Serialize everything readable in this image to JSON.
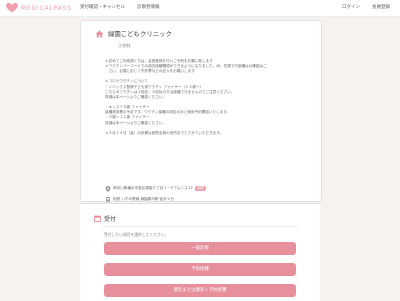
{
  "colors": {
    "brand": "#f2a1ac",
    "primary_button": "#e88f9c",
    "page_bg": "#f6f2ef"
  },
  "header": {
    "logo_icon": "heart-logo-icon",
    "logo_text": "MEDICALPASS",
    "nav": [
      "受付確認・キャンセル",
      "診察券情報"
    ],
    "login": "ログイン",
    "register": "会員登録"
  },
  "clinic": {
    "icon": "home-icon",
    "name": "緑園こどもクリニック",
    "department": "小児科"
  },
  "notice": [
    "＊初めてご利用頂く方は、会員登録を行いご予約をお願い致します",
    "＊ワクチンバーコードでの過去接種確認ができるようになりました。尚、先頭で行接種はの確認はご",
    "　さい。必要に応じて予診票などの記入をお願いします",
    "",
    "＊コロナワクチンについて",
    "・ノバックス登録子ども用ワクチン ファイザー（１２歳～）",
    "こちらのワクチンは１回目・２回目の方は接種できませんのでご注意ください。",
    "詳細は本ページよりご確認ください。",
    "",
    "・キッズ＋４歳 ファイザー",
    "接種券到着の予定です。ワクチン接種の設定のあと使用予約開始いたします。",
    "・５歳～１１歳 ファイザー",
    "詳細は本ページよりご確認ください。",
    "",
    "＊４月１４日（金）の診察は医院全員の来所までとさせていただきます。"
  ],
  "info": {
    "address": "神奈川県横浜市泉区緑園２丁目１−５アムニス２F",
    "map_label": "地図",
    "access": "相鉄 いずみ野線 緑園都市駅 徒歩２分",
    "phone": "045-813-0000"
  },
  "reception": {
    "icon": "calendar-icon",
    "title": "受付",
    "hint": "受付したい項目を選択してください。",
    "buttons": [
      "一般診察",
      "予防接種",
      "健診または健診＋予防接種"
    ]
  }
}
